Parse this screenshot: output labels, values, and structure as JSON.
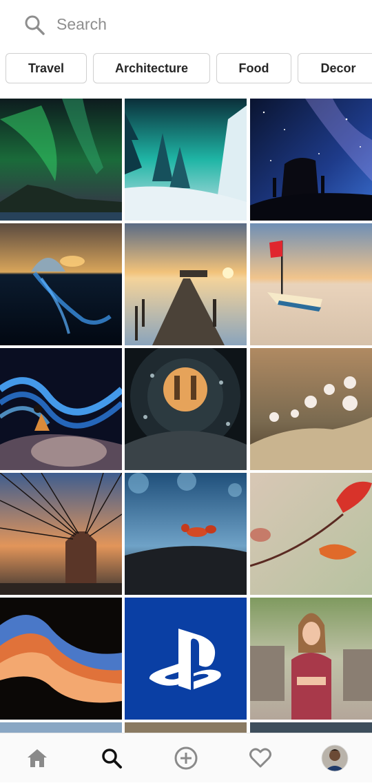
{
  "search": {
    "placeholder": "Search",
    "icon": "search-icon"
  },
  "categories": [
    {
      "label": "Travel"
    },
    {
      "label": "Architecture"
    },
    {
      "label": "Food"
    },
    {
      "label": "Decor"
    }
  ],
  "grid": {
    "tiles": [
      {
        "subject": "aurora-over-mountains"
      },
      {
        "subject": "snowy-forest-aurora"
      },
      {
        "subject": "milky-way-silhouettes"
      },
      {
        "subject": "jellyfish-sunset-split"
      },
      {
        "subject": "pier-at-sunset"
      },
      {
        "subject": "boat-with-red-flag"
      },
      {
        "subject": "light-painting-person"
      },
      {
        "subject": "water-drop-tunnel"
      },
      {
        "subject": "mushrooms-bokeh"
      },
      {
        "subject": "bridge-cables-sunset"
      },
      {
        "subject": "ant-macro-blue-bokeh"
      },
      {
        "subject": "autumn-leaves-branch"
      },
      {
        "subject": "antelope-canyon"
      },
      {
        "subject": "playstation-logo"
      },
      {
        "subject": "woman-on-bridge"
      }
    ]
  },
  "nav": [
    {
      "icon": "home-icon"
    },
    {
      "icon": "search-icon"
    },
    {
      "icon": "add-icon"
    },
    {
      "icon": "heart-icon"
    },
    {
      "icon": "profile-avatar"
    }
  ],
  "colors": {
    "text": "#262626",
    "placeholder": "#8e8e8e",
    "chip_border": "#cfcfcf",
    "nav_bg": "#fafafa"
  }
}
